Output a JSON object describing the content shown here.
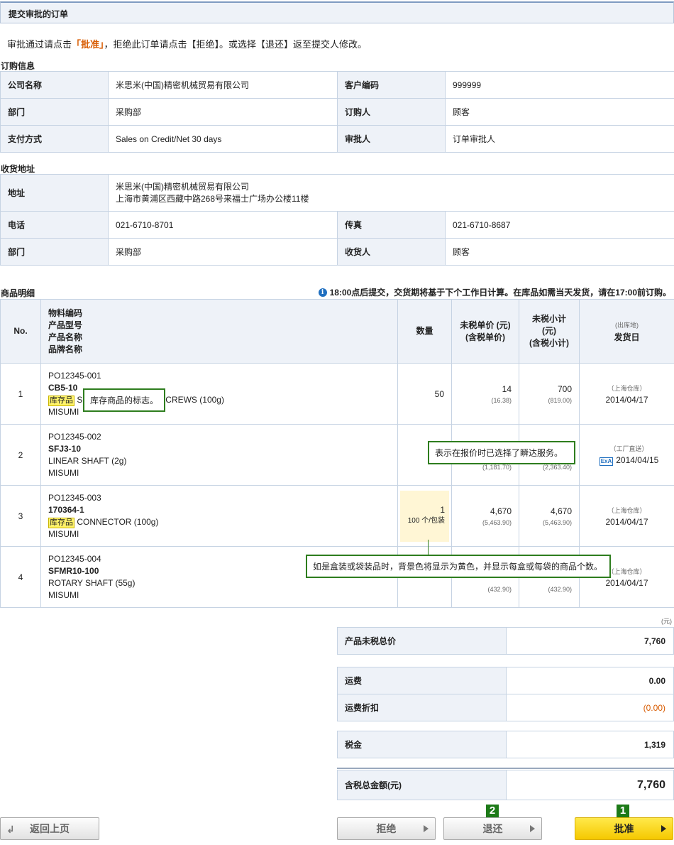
{
  "header": {
    "title": "提交审批的订单"
  },
  "intro": {
    "pre": "审批通过请点击",
    "highlight": "「批准」",
    "post": "，拒绝此订单请点击【拒绝】。或选择【退还】返至提交人修改。"
  },
  "order_info": {
    "section_title": "订购信息",
    "rows": [
      {
        "k1": "公司名称",
        "v1": "米思米(中国)精密机械贸易有限公司",
        "k2": "客户编码",
        "v2": "999999"
      },
      {
        "k1": "部门",
        "v1": "采购部",
        "k2": "订购人",
        "v2": "顾客"
      },
      {
        "k1": "支付方式",
        "v1": "Sales on Credit/Net 30 days",
        "k2": "审批人",
        "v2": "订单审批人"
      }
    ]
  },
  "ship_info": {
    "section_title": "收货地址",
    "address_label": "地址",
    "address_line1": "米思米(中国)精密机械贸易有限公司",
    "address_line2": "上海市黄浦区西藏中路268号来福士广场办公楼11楼",
    "rows": [
      {
        "k1": "电话",
        "v1": "021-6710-8701",
        "k2": "传真",
        "v2": "021-6710-8687"
      },
      {
        "k1": "部门",
        "v1": "采购部",
        "k2": "收货人",
        "v2": "顾客"
      }
    ]
  },
  "items": {
    "section_title": "商品明细",
    "notice": "18:00点后提交，交货期将基于下个工作日计算。在库品如需当天发货，请在17:00前订购。",
    "headers": {
      "no": "No.",
      "part1": "物料编码",
      "part2": "产品型号",
      "part3": "产品名称",
      "part4": "品牌名称",
      "qty": "数量",
      "price1": "未税单价 (元)",
      "price2": "(含税单价)",
      "sub1": "未税小计",
      "sub2": "(元)",
      "sub3": "(含税小计)",
      "ship1": "(出库地)",
      "ship2": "发货日"
    },
    "rows": [
      {
        "no": "1",
        "code": "PO12345-001",
        "model": "CB5-10",
        "stock": "库存品",
        "name": "SOCKET HEAD CAP SCREWS (100g)",
        "brand": "MISUMI",
        "qty": "50",
        "unit": "",
        "price": "14",
        "price_tax": "(16.38)",
        "sub": "700",
        "sub_tax": "(819.00)",
        "loc": "（上海仓库）",
        "date": "2014/04/17"
      },
      {
        "no": "2",
        "code": "PO12345-002",
        "model": "SFJ3-10",
        "stock": "",
        "name": "LINEAR SHAFT (2g)",
        "brand": "MISUMI",
        "qty": "",
        "unit": "",
        "price": "",
        "price_tax": "(1,181.70)",
        "sub": "",
        "sub_tax": "(2,363.40)",
        "loc": "（工厂直送）",
        "date": "2014/04/15"
      },
      {
        "no": "3",
        "code": "PO12345-003",
        "model": "170364-1",
        "stock": "库存品",
        "name": "CONNECTOR (100g)",
        "brand": "MISUMI",
        "qty": "1",
        "unit": "100 个/包装",
        "price": "4,670",
        "price_tax": "(5,463.90)",
        "sub": "4,670",
        "sub_tax": "(5,463.90)",
        "loc": "（上海仓库）",
        "date": "2014/04/17"
      },
      {
        "no": "4",
        "code": "PO12345-004",
        "model": "SFMR10-100",
        "stock": "",
        "name": "ROTARY SHAFT (55g)",
        "brand": "MISUMI",
        "qty": "",
        "unit": "",
        "price": "",
        "price_tax": "(432.90)",
        "sub": "",
        "sub_tax": "(432.90)",
        "loc": "（上海仓库）",
        "date": "2014/04/17"
      }
    ],
    "express_icon": "ExA"
  },
  "callouts": {
    "stock": "库存商品的标志。",
    "express": "表示在报价时已选择了瞬达服务。",
    "package": "如是盒装或袋装品时，背景色将显示为黄色，并显示每盒或每袋的商品个数。"
  },
  "totals": {
    "unit": "(元)",
    "subtotal_label": "产品未税总价",
    "subtotal": "7,760",
    "freight_label": "运费",
    "freight": "0.00",
    "discount_label": "运费折扣",
    "discount": "(0.00)",
    "tax_label": "税金",
    "tax": "1,319",
    "total_label": "含税总金额(元)",
    "total": "7,760"
  },
  "buttons": {
    "back": "返回上页",
    "reject": "拒绝",
    "return": "退还",
    "approve": "批准",
    "badge_return": "2",
    "badge_approve": "1"
  },
  "colors": {
    "accent_orange": "#d85b00",
    "approve_yellow": "#ffd800",
    "callout_green": "#2e7d1e",
    "header_bg": "#eef2f8"
  }
}
